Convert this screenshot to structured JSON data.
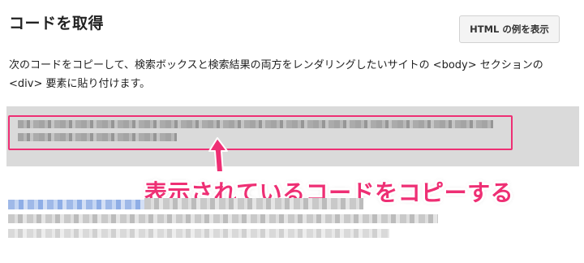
{
  "header": {
    "title": "コードを取得",
    "example_button_label": "HTML の例を表示"
  },
  "description": "次のコードをコピーして、検索ボックスと検索結果の両方をレンダリングしたいサイトの <body> セクションの <div> 要素に貼り付けます。",
  "annotation": {
    "callout_text": "表示されているコードをコピーする",
    "accent_color": "#ee2f74"
  }
}
